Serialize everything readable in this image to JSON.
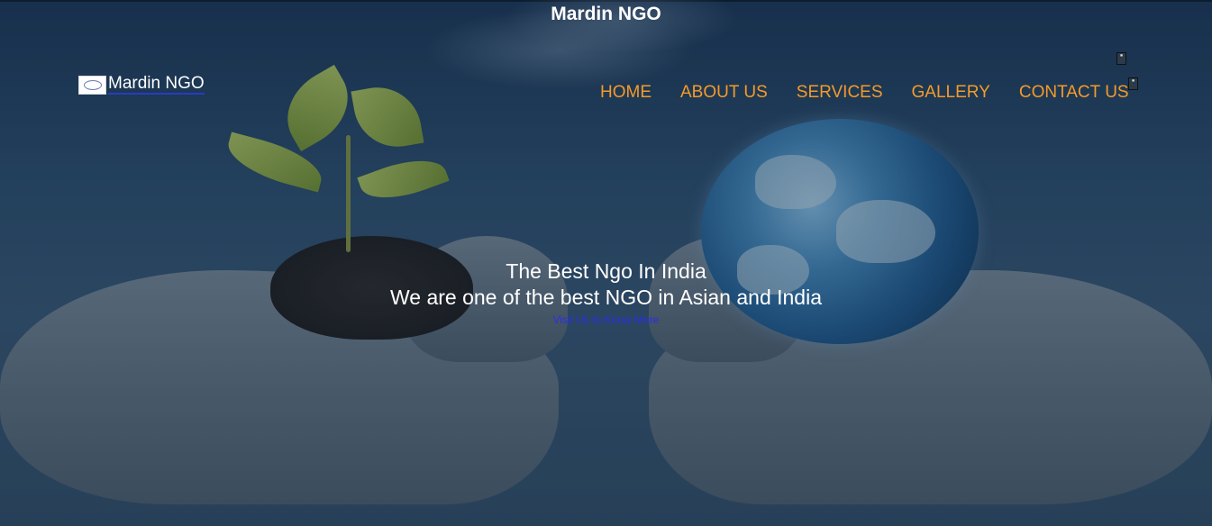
{
  "site": {
    "name_top": "Mardin NGO",
    "logo_text": "Mardin NGO"
  },
  "nav": {
    "items": [
      {
        "label": "HOME"
      },
      {
        "label": "ABOUT US"
      },
      {
        "label": "SERVICES"
      },
      {
        "label": "GALLERY"
      },
      {
        "label": "CONTACT US"
      }
    ],
    "color": "#f59a2a"
  },
  "hero": {
    "title": "The Best Ngo In India",
    "subtitle": "We are one of the best NGO in Asian and India",
    "link_label": "Visit Us to Know More"
  },
  "icons": {
    "broken_image_1": "broken-image-icon",
    "broken_image_2": "broken-image-icon"
  }
}
